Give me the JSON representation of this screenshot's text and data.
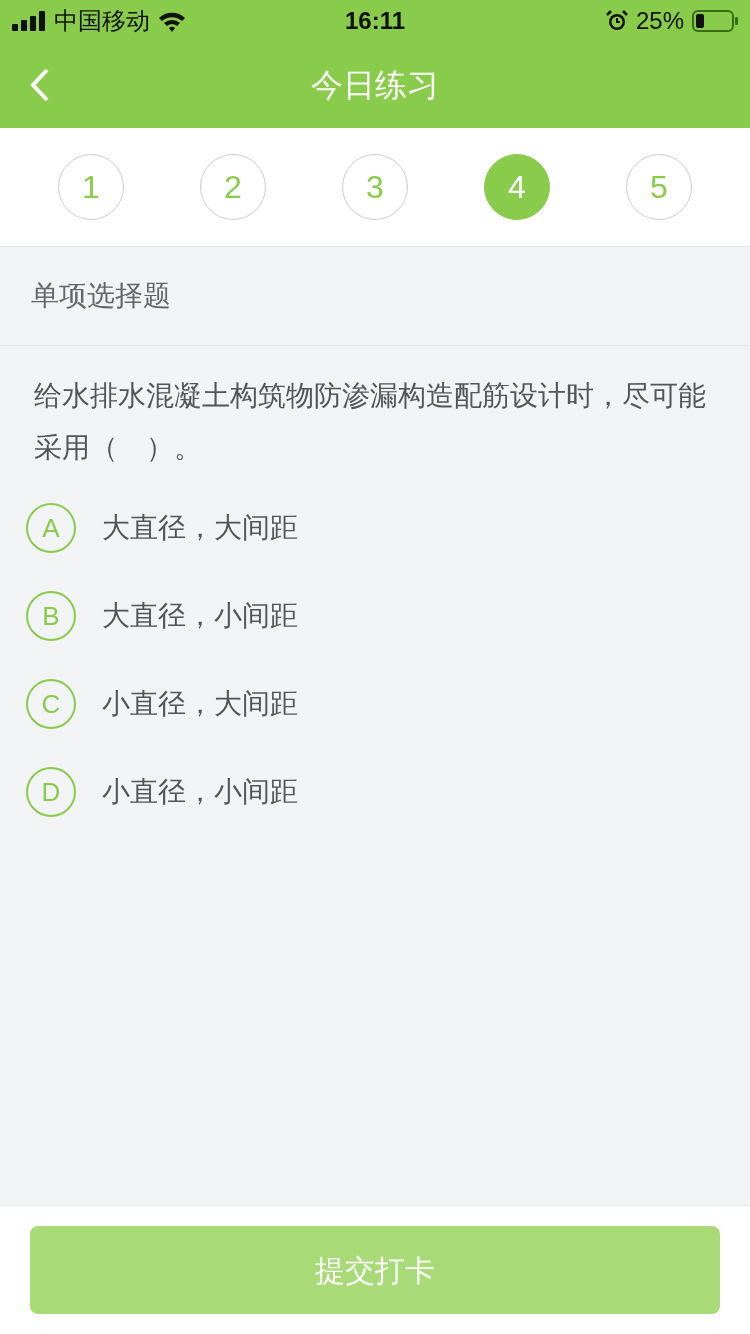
{
  "status_bar": {
    "carrier": "中国移动",
    "time": "16:11",
    "battery": "25%"
  },
  "nav": {
    "title": "今日练习"
  },
  "steps": [
    {
      "label": "1",
      "selected": false
    },
    {
      "label": "2",
      "selected": false
    },
    {
      "label": "3",
      "selected": false
    },
    {
      "label": "4",
      "selected": true
    },
    {
      "label": "5",
      "selected": false
    }
  ],
  "question": {
    "type": "单项选择题",
    "text": "给水排水混凝土构筑物防渗漏构造配筋设计时，尽可能采用（　）。",
    "options": [
      {
        "letter": "A",
        "text": "大直径，大间距",
        "selected": false
      },
      {
        "letter": "B",
        "text": "大直径，小间距",
        "selected": false
      },
      {
        "letter": "C",
        "text": "小直径，大间距",
        "selected": false
      },
      {
        "letter": "D",
        "text": "小直径，小间距",
        "selected": false
      }
    ]
  },
  "submit": {
    "label": "提交打卡",
    "disabled": true
  }
}
